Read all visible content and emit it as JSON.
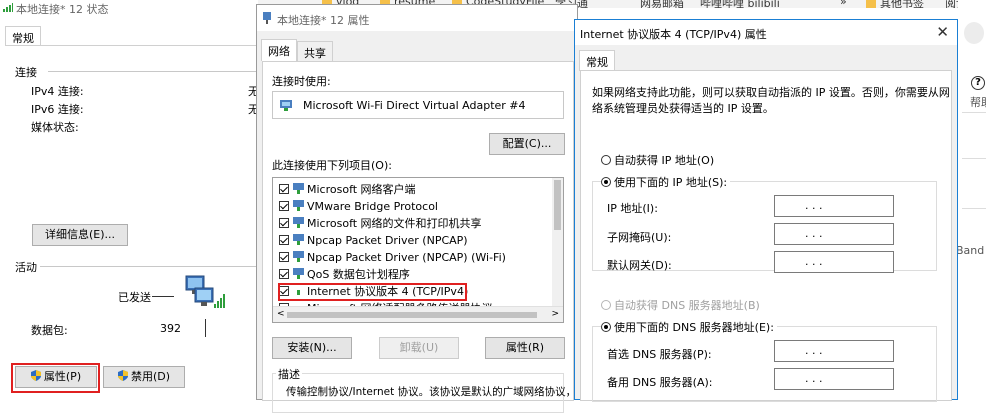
{
  "bookmarks_bar": {
    "items": [
      "vlog",
      "resume",
      "CodeStudyFile",
      "学习通",
      "网易邮箱",
      "哔哩哔哩 bilibili",
      "»",
      "其他书签",
      "阅读"
    ]
  },
  "status_window": {
    "title": "本地连接* 12 状态",
    "tab": "常规",
    "connection_label": "连接",
    "ipv4_label": "IPv4 连接:",
    "ipv4_value": "无",
    "ipv6_label": "IPv6 连接:",
    "ipv6_value": "无",
    "media_label": "媒体状态:",
    "details_button": "详细信息(E)...",
    "activity_label": "活动",
    "sent_label": "已发送",
    "packets_label": "数据包:",
    "packets_sent": "392",
    "properties_button": "属性(P)",
    "disable_button": "禁用(D)"
  },
  "adapter_window": {
    "title": "本地连接* 12 属性",
    "tabs": [
      "网络",
      "共享"
    ],
    "connect_using_label": "连接时使用:",
    "adapter_name": "Microsoft Wi-Fi Direct Virtual Adapter #4",
    "configure_button": "配置(C)...",
    "items_label": "此连接使用下列项目(O):",
    "items": [
      {
        "label": "Microsoft 网络客户端",
        "checked": true
      },
      {
        "label": "VMware Bridge Protocol",
        "checked": true
      },
      {
        "label": "Microsoft 网络的文件和打印机共享",
        "checked": true
      },
      {
        "label": "Npcap Packet Driver (NPCAP)",
        "checked": true
      },
      {
        "label": "Npcap Packet Driver (NPCAP) (Wi-Fi)",
        "checked": true
      },
      {
        "label": "QoS 数据包计划程序",
        "checked": true
      },
      {
        "label": "Internet 协议版本 4 (TCP/IPv4)",
        "checked": true
      },
      {
        "label": "Microsoft 网络适配器多路传送器协议",
        "checked": false
      }
    ],
    "install_button": "安装(N)...",
    "uninstall_button": "卸载(U)",
    "properties_button": "属性(R)",
    "description_label": "描述",
    "description_text": "传输控制协议/Internet 协议。该协议是默认的广域网络协议，用"
  },
  "ipv4_window": {
    "title": "Internet 协议版本 4 (TCP/IPv4) 属性",
    "close_glyph": "✕",
    "tab": "常规",
    "intro_line1": "如果网络支持此功能，则可以获取自动指派的 IP 设置。否则，你需要从网",
    "intro_line2": "络系统管理员处获得适当的 IP 设置。",
    "auto_ip_label": "自动获得 IP 地址(O)",
    "manual_ip_label": "使用下面的 IP 地址(S):",
    "ip_label": "IP 地址(I):",
    "mask_label": "子网掩码(U):",
    "gateway_label": "默认网关(D):",
    "auto_dns_label": "自动获得 DNS 服务器地址(B)",
    "manual_dns_label": "使用下面的 DNS 服务器地址(E):",
    "dns1_label": "首选 DNS 服务器(P):",
    "dns2_label": "备用 DNS 服务器(A):",
    "ip_dots": ".      .      ."
  },
  "background_right": {
    "help_glyph": "?",
    "help_text": "帮助",
    "band_text": "Band V"
  }
}
